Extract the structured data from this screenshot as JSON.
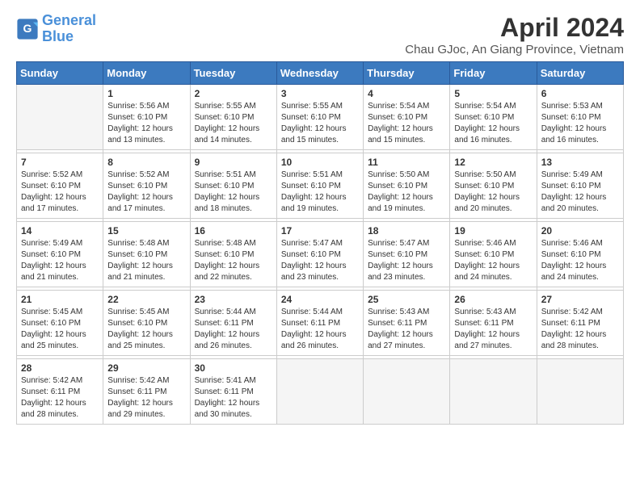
{
  "logo": {
    "line1": "General",
    "line2": "Blue"
  },
  "title": "April 2024",
  "subtitle": "Chau GJoc, An Giang Province, Vietnam",
  "weekdays": [
    "Sunday",
    "Monday",
    "Tuesday",
    "Wednesday",
    "Thursday",
    "Friday",
    "Saturday"
  ],
  "weeks": [
    [
      {
        "day": "",
        "sunrise": "",
        "sunset": "",
        "daylight": ""
      },
      {
        "day": "1",
        "sunrise": "Sunrise: 5:56 AM",
        "sunset": "Sunset: 6:10 PM",
        "daylight": "Daylight: 12 hours and 13 minutes."
      },
      {
        "day": "2",
        "sunrise": "Sunrise: 5:55 AM",
        "sunset": "Sunset: 6:10 PM",
        "daylight": "Daylight: 12 hours and 14 minutes."
      },
      {
        "day": "3",
        "sunrise": "Sunrise: 5:55 AM",
        "sunset": "Sunset: 6:10 PM",
        "daylight": "Daylight: 12 hours and 15 minutes."
      },
      {
        "day": "4",
        "sunrise": "Sunrise: 5:54 AM",
        "sunset": "Sunset: 6:10 PM",
        "daylight": "Daylight: 12 hours and 15 minutes."
      },
      {
        "day": "5",
        "sunrise": "Sunrise: 5:54 AM",
        "sunset": "Sunset: 6:10 PM",
        "daylight": "Daylight: 12 hours and 16 minutes."
      },
      {
        "day": "6",
        "sunrise": "Sunrise: 5:53 AM",
        "sunset": "Sunset: 6:10 PM",
        "daylight": "Daylight: 12 hours and 16 minutes."
      }
    ],
    [
      {
        "day": "7",
        "sunrise": "Sunrise: 5:52 AM",
        "sunset": "Sunset: 6:10 PM",
        "daylight": "Daylight: 12 hours and 17 minutes."
      },
      {
        "day": "8",
        "sunrise": "Sunrise: 5:52 AM",
        "sunset": "Sunset: 6:10 PM",
        "daylight": "Daylight: 12 hours and 17 minutes."
      },
      {
        "day": "9",
        "sunrise": "Sunrise: 5:51 AM",
        "sunset": "Sunset: 6:10 PM",
        "daylight": "Daylight: 12 hours and 18 minutes."
      },
      {
        "day": "10",
        "sunrise": "Sunrise: 5:51 AM",
        "sunset": "Sunset: 6:10 PM",
        "daylight": "Daylight: 12 hours and 19 minutes."
      },
      {
        "day": "11",
        "sunrise": "Sunrise: 5:50 AM",
        "sunset": "Sunset: 6:10 PM",
        "daylight": "Daylight: 12 hours and 19 minutes."
      },
      {
        "day": "12",
        "sunrise": "Sunrise: 5:50 AM",
        "sunset": "Sunset: 6:10 PM",
        "daylight": "Daylight: 12 hours and 20 minutes."
      },
      {
        "day": "13",
        "sunrise": "Sunrise: 5:49 AM",
        "sunset": "Sunset: 6:10 PM",
        "daylight": "Daylight: 12 hours and 20 minutes."
      }
    ],
    [
      {
        "day": "14",
        "sunrise": "Sunrise: 5:49 AM",
        "sunset": "Sunset: 6:10 PM",
        "daylight": "Daylight: 12 hours and 21 minutes."
      },
      {
        "day": "15",
        "sunrise": "Sunrise: 5:48 AM",
        "sunset": "Sunset: 6:10 PM",
        "daylight": "Daylight: 12 hours and 21 minutes."
      },
      {
        "day": "16",
        "sunrise": "Sunrise: 5:48 AM",
        "sunset": "Sunset: 6:10 PM",
        "daylight": "Daylight: 12 hours and 22 minutes."
      },
      {
        "day": "17",
        "sunrise": "Sunrise: 5:47 AM",
        "sunset": "Sunset: 6:10 PM",
        "daylight": "Daylight: 12 hours and 23 minutes."
      },
      {
        "day": "18",
        "sunrise": "Sunrise: 5:47 AM",
        "sunset": "Sunset: 6:10 PM",
        "daylight": "Daylight: 12 hours and 23 minutes."
      },
      {
        "day": "19",
        "sunrise": "Sunrise: 5:46 AM",
        "sunset": "Sunset: 6:10 PM",
        "daylight": "Daylight: 12 hours and 24 minutes."
      },
      {
        "day": "20",
        "sunrise": "Sunrise: 5:46 AM",
        "sunset": "Sunset: 6:10 PM",
        "daylight": "Daylight: 12 hours and 24 minutes."
      }
    ],
    [
      {
        "day": "21",
        "sunrise": "Sunrise: 5:45 AM",
        "sunset": "Sunset: 6:10 PM",
        "daylight": "Daylight: 12 hours and 25 minutes."
      },
      {
        "day": "22",
        "sunrise": "Sunrise: 5:45 AM",
        "sunset": "Sunset: 6:10 PM",
        "daylight": "Daylight: 12 hours and 25 minutes."
      },
      {
        "day": "23",
        "sunrise": "Sunrise: 5:44 AM",
        "sunset": "Sunset: 6:11 PM",
        "daylight": "Daylight: 12 hours and 26 minutes."
      },
      {
        "day": "24",
        "sunrise": "Sunrise: 5:44 AM",
        "sunset": "Sunset: 6:11 PM",
        "daylight": "Daylight: 12 hours and 26 minutes."
      },
      {
        "day": "25",
        "sunrise": "Sunrise: 5:43 AM",
        "sunset": "Sunset: 6:11 PM",
        "daylight": "Daylight: 12 hours and 27 minutes."
      },
      {
        "day": "26",
        "sunrise": "Sunrise: 5:43 AM",
        "sunset": "Sunset: 6:11 PM",
        "daylight": "Daylight: 12 hours and 27 minutes."
      },
      {
        "day": "27",
        "sunrise": "Sunrise: 5:42 AM",
        "sunset": "Sunset: 6:11 PM",
        "daylight": "Daylight: 12 hours and 28 minutes."
      }
    ],
    [
      {
        "day": "28",
        "sunrise": "Sunrise: 5:42 AM",
        "sunset": "Sunset: 6:11 PM",
        "daylight": "Daylight: 12 hours and 28 minutes."
      },
      {
        "day": "29",
        "sunrise": "Sunrise: 5:42 AM",
        "sunset": "Sunset: 6:11 PM",
        "daylight": "Daylight: 12 hours and 29 minutes."
      },
      {
        "day": "30",
        "sunrise": "Sunrise: 5:41 AM",
        "sunset": "Sunset: 6:11 PM",
        "daylight": "Daylight: 12 hours and 30 minutes."
      },
      {
        "day": "",
        "sunrise": "",
        "sunset": "",
        "daylight": ""
      },
      {
        "day": "",
        "sunrise": "",
        "sunset": "",
        "daylight": ""
      },
      {
        "day": "",
        "sunrise": "",
        "sunset": "",
        "daylight": ""
      },
      {
        "day": "",
        "sunrise": "",
        "sunset": "",
        "daylight": ""
      }
    ]
  ]
}
